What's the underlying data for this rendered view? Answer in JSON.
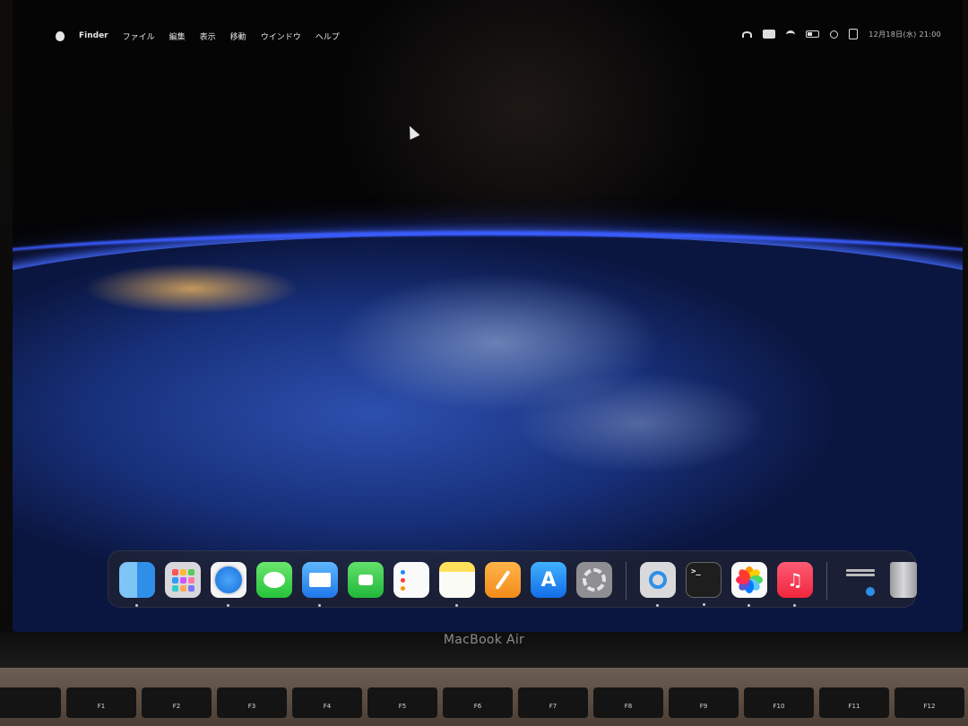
{
  "menubar": {
    "items": [
      "Finder",
      "ファイル",
      "編集",
      "表示",
      "移動",
      "ウインドウ",
      "ヘルプ"
    ],
    "clock": "12月18日(水) 21:00"
  },
  "icons": {
    "menubar_right": [
      "airdrop-icon",
      "app-badge-icon",
      "wifi-icon",
      "battery-icon",
      "search-icon",
      "control-center-icon"
    ]
  },
  "dock": {
    "apps": [
      {
        "name": "Finder",
        "running": true
      },
      {
        "name": "Launchpad",
        "running": false
      },
      {
        "name": "Safari",
        "running": true
      },
      {
        "name": "Messages",
        "running": false
      },
      {
        "name": "Mail",
        "running": true
      },
      {
        "name": "FaceTime",
        "running": false
      },
      {
        "name": "Reminders",
        "running": false
      },
      {
        "name": "Notes",
        "running": true
      },
      {
        "name": "Pages",
        "running": false
      },
      {
        "name": "App Store",
        "running": false
      },
      {
        "name": "System Settings",
        "running": false
      },
      {
        "name": "QuickTime Player",
        "running": true
      },
      {
        "name": "Terminal",
        "running": true
      },
      {
        "name": "Photos",
        "running": true
      },
      {
        "name": "Music",
        "running": true
      }
    ]
  },
  "laptop": {
    "brand": "MacBook Air",
    "fkeys": [
      "F1",
      "F2",
      "F3",
      "F4",
      "F5",
      "F6",
      "F7",
      "F8",
      "F9",
      "F10",
      "F11",
      "F12"
    ]
  }
}
